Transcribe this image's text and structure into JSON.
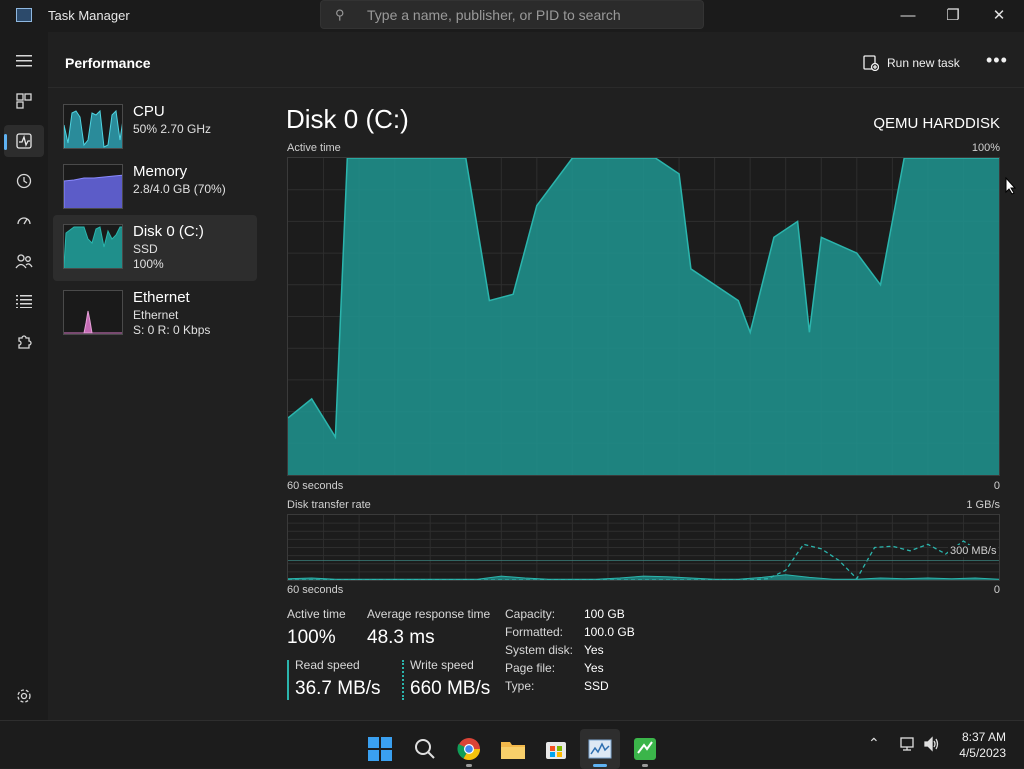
{
  "window": {
    "title": "Task Manager"
  },
  "search": {
    "placeholder": "Type a name, publisher, or PID to search"
  },
  "header": {
    "title": "Performance",
    "run_new_task": "Run new task"
  },
  "nav": [
    {
      "name": "hamburger-menu-icon"
    },
    {
      "name": "processes-icon"
    },
    {
      "name": "performance-icon",
      "active": true
    },
    {
      "name": "app-history-icon"
    },
    {
      "name": "startup-apps-icon"
    },
    {
      "name": "users-icon"
    },
    {
      "name": "details-icon"
    },
    {
      "name": "services-icon"
    },
    {
      "name": "settings-icon"
    }
  ],
  "resources": [
    {
      "name": "CPU",
      "sub1": "50%  2.70 GHz",
      "sub2": ""
    },
    {
      "name": "Memory",
      "sub1": "2.8/4.0 GB (70%)",
      "sub2": ""
    },
    {
      "name": "Disk 0 (C:)",
      "sub1": "SSD",
      "sub2": "100%"
    },
    {
      "name": "Ethernet",
      "sub1": "Ethernet",
      "sub2": "S: 0  R: 0 Kbps"
    }
  ],
  "disk": {
    "title": "Disk 0 (C:)",
    "model": "QEMU HARDDISK",
    "active_time_label": "Active time",
    "active_time_max": "100%",
    "time_left": "60 seconds",
    "time_right": "0",
    "transfer_label": "Disk transfer rate",
    "transfer_max": "1 GB/s",
    "transfer_marker": "300 MB/s"
  },
  "stats": {
    "active_time_label": "Active time",
    "active_time_value": "100%",
    "response_label": "Average response time",
    "response_value": "48.3 ms",
    "read_label": "Read speed",
    "read_value": "36.7 MB/s",
    "write_label": "Write speed",
    "write_value": "660 MB/s"
  },
  "properties": [
    {
      "label": "Capacity:",
      "value": "100 GB"
    },
    {
      "label": "Formatted:",
      "value": "100.0 GB"
    },
    {
      "label": "System disk:",
      "value": "Yes"
    },
    {
      "label": "Page file:",
      "value": "Yes"
    },
    {
      "label": "Type:",
      "value": "SSD"
    }
  ],
  "taskbar": {
    "time": "8:37 AM",
    "date": "4/5/2023"
  },
  "colors": {
    "disk_fill": "#1f8f8b",
    "disk_line": "#2bb5ad",
    "accent": "#5fb2f2",
    "memory_fill": "#6a6ad8",
    "ethernet_fill": "#d77bc7"
  },
  "chart_data": [
    {
      "type": "area",
      "title": "Active time",
      "x": [
        60,
        58,
        56,
        55,
        53,
        51,
        49,
        47,
        45,
        43,
        41,
        39,
        38,
        36,
        34,
        32,
        30,
        29,
        27,
        26,
        24,
        22,
        21,
        19,
        17,
        16,
        15,
        12,
        10,
        8,
        5,
        2,
        0
      ],
      "values": [
        18,
        24,
        12,
        100,
        100,
        100,
        100,
        100,
        100,
        55,
        57,
        85,
        90,
        100,
        100,
        100,
        100,
        100,
        95,
        65,
        60,
        55,
        45,
        75,
        80,
        45,
        75,
        70,
        60,
        100,
        100,
        100,
        100
      ],
      "ylim": [
        0,
        100
      ],
      "xlabel": "60 seconds",
      "ymax_label": "100%"
    },
    {
      "type": "line",
      "title": "Disk transfer rate",
      "series": [
        {
          "values": [
            2,
            3,
            1,
            1,
            1,
            1,
            1,
            1,
            1,
            6,
            3,
            1,
            1,
            1,
            3,
            6,
            5,
            3,
            1,
            1,
            4,
            8,
            4,
            1,
            1,
            3,
            2,
            3,
            2,
            3,
            1
          ]
        },
        {
          "values": [
            0,
            0,
            0,
            0,
            0,
            0,
            0,
            0,
            0,
            0,
            0,
            0,
            0,
            0,
            0,
            0,
            0,
            0,
            0,
            0,
            0,
            0,
            0,
            0,
            0,
            0,
            0,
            2,
            15,
            55,
            48,
            30,
            2,
            50,
            52,
            45,
            55,
            40,
            60,
            42,
            50
          ]
        }
      ],
      "ylim": [
        0,
        100
      ],
      "ymax_label": "1 GB/s"
    }
  ]
}
